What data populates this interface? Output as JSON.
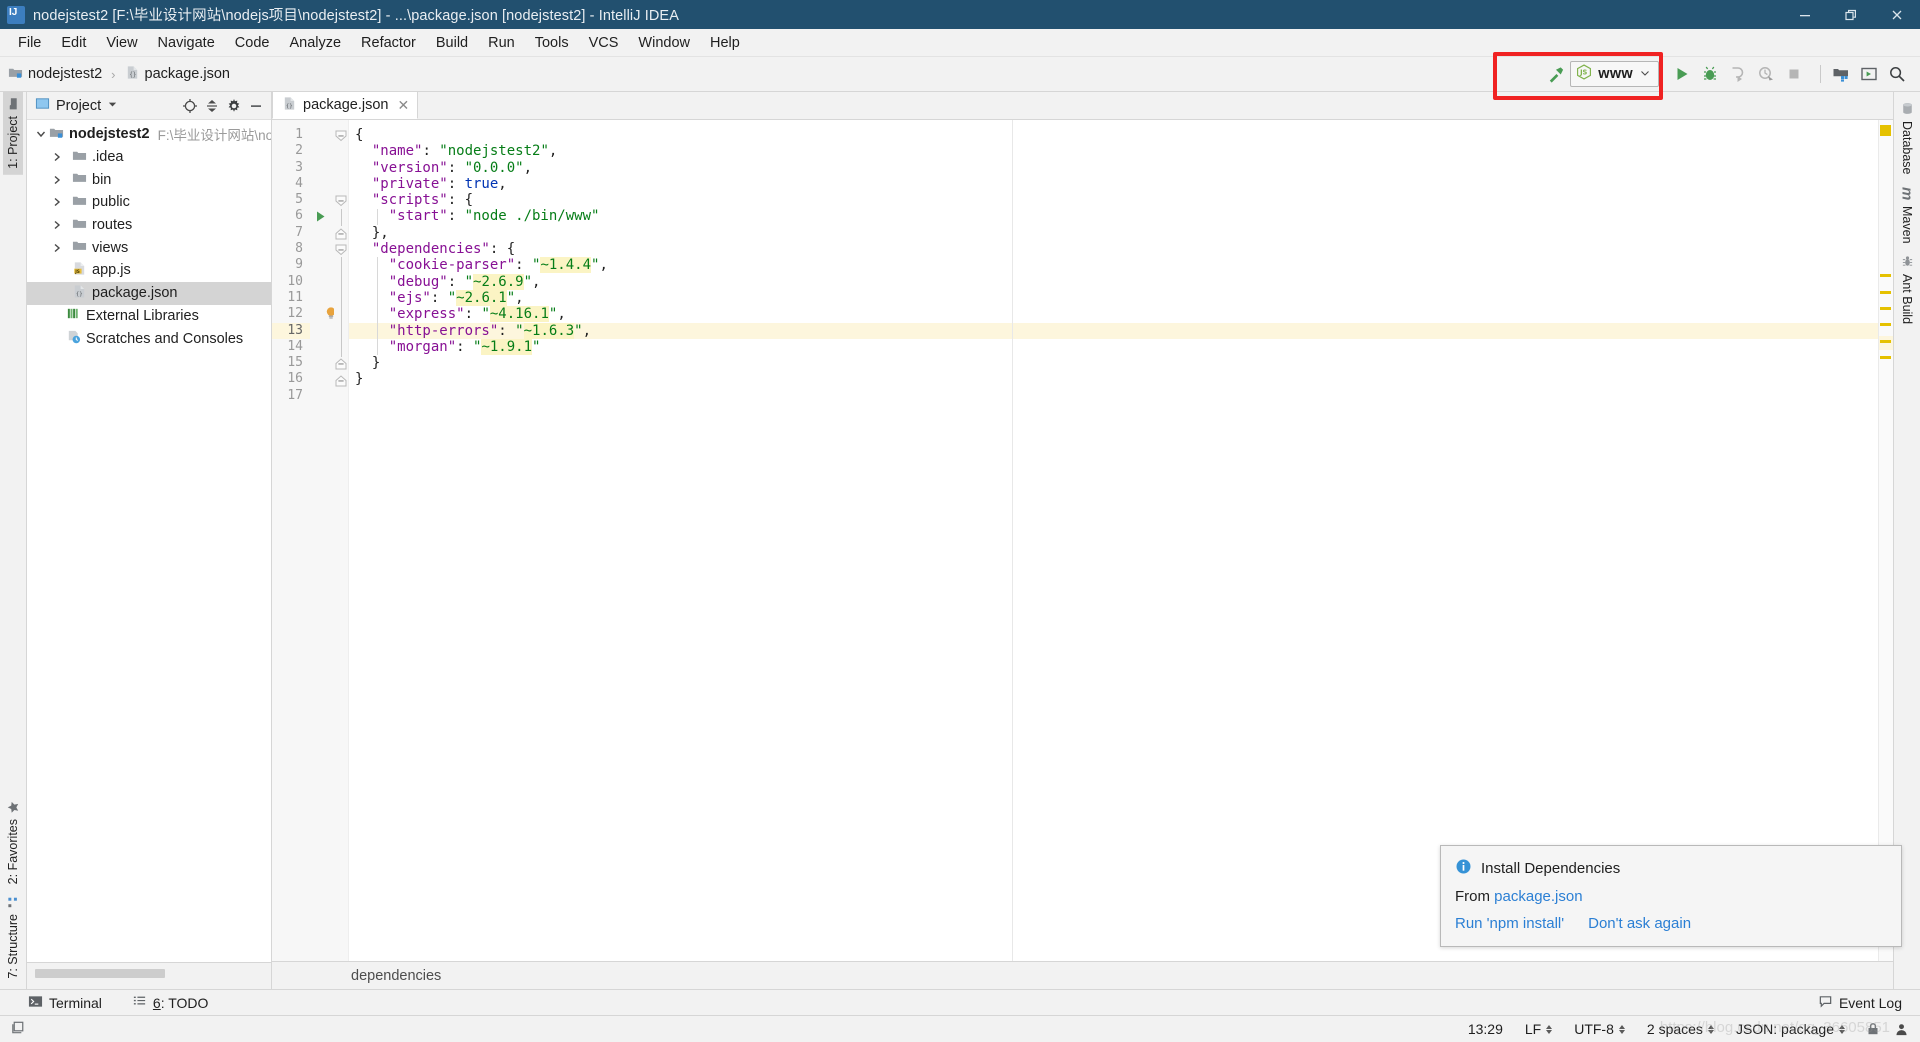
{
  "window": {
    "title": "nodejstest2 [F:\\毕业设计网站\\nodejs项目\\nodejstest2] - ...\\package.json [nodejstest2] - IntelliJ IDEA",
    "app_icon": "intellij-idea-icon",
    "minimize_label": "minimize-icon",
    "restore_label": "restore-icon",
    "close_label": "close-icon",
    "titlebar_color": "#22506f"
  },
  "menu": {
    "items": [
      {
        "label": "File"
      },
      {
        "label": "Edit"
      },
      {
        "label": "View"
      },
      {
        "label": "Navigate"
      },
      {
        "label": "Code"
      },
      {
        "label": "Analyze"
      },
      {
        "label": "Refactor"
      },
      {
        "label": "Build"
      },
      {
        "label": "Run"
      },
      {
        "label": "Tools"
      },
      {
        "label": "VCS"
      },
      {
        "label": "Window"
      },
      {
        "label": "Help"
      }
    ]
  },
  "navbar": {
    "breadcrumb": [
      {
        "label": "nodejstest2",
        "icon": "module-folder-icon"
      },
      {
        "label": "package.json",
        "icon": "json-file-icon"
      }
    ],
    "separator": "›",
    "build_button": "build-hammer-icon",
    "run_config": {
      "name": "www",
      "icon": "nodejs-icon",
      "dropdown": "chevron-down-icon"
    },
    "actions": [
      {
        "name": "run-button",
        "icon": "run-play-icon",
        "enabled": true
      },
      {
        "name": "debug-button",
        "icon": "debug-bug-icon",
        "enabled": true
      },
      {
        "name": "run-with-coverage-button",
        "icon": "coverage-icon",
        "enabled": false
      },
      {
        "name": "profile-button",
        "icon": "profiler-icon",
        "enabled": false
      },
      {
        "name": "stop-button",
        "icon": "stop-square-icon",
        "enabled": false
      }
    ],
    "right_actions": [
      {
        "name": "project-structure-button",
        "icon": "project-structure-icon"
      },
      {
        "name": "terminal-console-button",
        "icon": "console-window-icon"
      },
      {
        "name": "search-everywhere-button",
        "icon": "search-icon"
      }
    ],
    "highlight_color": "#f02222"
  },
  "left_strip": {
    "top_tabs": [
      {
        "label": "1: Project",
        "icon": "project-folder-icon",
        "active": true
      }
    ],
    "bottom_tabs": [
      {
        "label": "2: Favorites",
        "icon": "star-icon",
        "active": false
      },
      {
        "label": "7: Structure",
        "icon": "structure-icon",
        "active": false
      }
    ]
  },
  "right_strip": {
    "tabs": [
      {
        "label": "Database",
        "icon": "database-icon"
      },
      {
        "label": "Maven",
        "icon": "maven-m-icon"
      },
      {
        "label": "Ant Build",
        "icon": "ant-icon"
      }
    ]
  },
  "project_panel": {
    "title": "Project",
    "dropdown_icon": "chevron-down-icon",
    "toolbar": [
      {
        "name": "scroll-from-source-button",
        "icon": "target-icon"
      },
      {
        "name": "collapse-all-button",
        "icon": "collapse-all-icon"
      },
      {
        "name": "settings-button",
        "icon": "gear-icon"
      },
      {
        "name": "hide-button",
        "icon": "minus-icon"
      }
    ],
    "tree": [
      {
        "label": "nodejstest2",
        "path": "F:\\毕业设计网站\\nodej",
        "icon": "module-folder-icon",
        "indent": 0,
        "arrow": "expanded",
        "selected": false
      },
      {
        "label": ".idea",
        "icon": "folder-icon",
        "indent": 1,
        "arrow": "collapsed",
        "selected": false
      },
      {
        "label": "bin",
        "icon": "folder-icon",
        "indent": 1,
        "arrow": "collapsed",
        "selected": false
      },
      {
        "label": "public",
        "icon": "folder-icon",
        "indent": 1,
        "arrow": "collapsed",
        "selected": false
      },
      {
        "label": "routes",
        "icon": "folder-icon",
        "indent": 1,
        "arrow": "collapsed",
        "selected": false
      },
      {
        "label": "views",
        "icon": "folder-icon",
        "indent": 1,
        "arrow": "collapsed",
        "selected": false
      },
      {
        "label": "app.js",
        "icon": "js-file-icon",
        "indent": 1,
        "arrow": "none",
        "selected": false
      },
      {
        "label": "package.json",
        "icon": "json-file-icon",
        "indent": 1,
        "arrow": "none",
        "selected": true
      },
      {
        "label": "External Libraries",
        "icon": "libraries-icon",
        "indent": 0,
        "arrow": "none",
        "selected": false
      },
      {
        "label": "Scratches and Consoles",
        "icon": "scratches-icon",
        "indent": 0,
        "arrow": "none",
        "selected": false
      }
    ]
  },
  "editor": {
    "tabs": [
      {
        "label": "package.json",
        "icon": "json-file-icon",
        "active": true,
        "close_icon": "close-icon"
      }
    ],
    "breadcrumb_footer": "dependencies",
    "current_line": 13,
    "lines": [
      {
        "num": 1,
        "fold": "start",
        "run": false,
        "bulb": false,
        "tokens": [
          {
            "t": "{",
            "c": "p"
          }
        ]
      },
      {
        "num": 2,
        "fold": "none",
        "run": false,
        "bulb": false,
        "tokens": [
          {
            "t": "  \"name\"",
            "c": "k"
          },
          {
            "t": ": ",
            "c": "p"
          },
          {
            "t": "\"nodejstest2\"",
            "c": "s"
          },
          {
            "t": ",",
            "c": "p"
          }
        ]
      },
      {
        "num": 3,
        "fold": "none",
        "run": false,
        "bulb": false,
        "tokens": [
          {
            "t": "  \"version\"",
            "c": "k"
          },
          {
            "t": ": ",
            "c": "p"
          },
          {
            "t": "\"0.0.0\"",
            "c": "s"
          },
          {
            "t": ",",
            "c": "p"
          }
        ]
      },
      {
        "num": 4,
        "fold": "none",
        "run": false,
        "bulb": false,
        "tokens": [
          {
            "t": "  \"private\"",
            "c": "k"
          },
          {
            "t": ": ",
            "c": "p"
          },
          {
            "t": "true",
            "c": "b"
          },
          {
            "t": ",",
            "c": "p"
          }
        ]
      },
      {
        "num": 5,
        "fold": "start",
        "run": false,
        "bulb": false,
        "tokens": [
          {
            "t": "  \"scripts\"",
            "c": "k"
          },
          {
            "t": ": {",
            "c": "p"
          }
        ]
      },
      {
        "num": 6,
        "fold": "none",
        "run": true,
        "bulb": false,
        "tokens": [
          {
            "t": "    \"start\"",
            "c": "k"
          },
          {
            "t": ": ",
            "c": "p"
          },
          {
            "t": "\"node ./bin/www\"",
            "c": "s"
          }
        ]
      },
      {
        "num": 7,
        "fold": "end",
        "run": false,
        "bulb": false,
        "tokens": [
          {
            "t": "  },",
            "c": "p"
          }
        ]
      },
      {
        "num": 8,
        "fold": "start",
        "run": false,
        "bulb": false,
        "tokens": [
          {
            "t": "  \"dependencies\"",
            "c": "k"
          },
          {
            "t": ": {",
            "c": "p"
          }
        ]
      },
      {
        "num": 9,
        "fold": "none",
        "run": false,
        "bulb": false,
        "tokens": [
          {
            "t": "    \"cookie-parser\"",
            "c": "k"
          },
          {
            "t": ": ",
            "c": "p"
          },
          {
            "t": "\"",
            "c": "s"
          },
          {
            "t": "~1.4.4",
            "c": "s hl"
          },
          {
            "t": "\"",
            "c": "s"
          },
          {
            "t": ",",
            "c": "p"
          }
        ]
      },
      {
        "num": 10,
        "fold": "none",
        "run": false,
        "bulb": false,
        "tokens": [
          {
            "t": "    \"debug\"",
            "c": "k"
          },
          {
            "t": ": ",
            "c": "p"
          },
          {
            "t": "\"",
            "c": "s"
          },
          {
            "t": "~2.6.9",
            "c": "s hl"
          },
          {
            "t": "\"",
            "c": "s"
          },
          {
            "t": ",",
            "c": "p"
          }
        ]
      },
      {
        "num": 11,
        "fold": "none",
        "run": false,
        "bulb": false,
        "tokens": [
          {
            "t": "    \"ejs\"",
            "c": "k"
          },
          {
            "t": ": ",
            "c": "p"
          },
          {
            "t": "\"",
            "c": "s"
          },
          {
            "t": "~2.6.1",
            "c": "s hl"
          },
          {
            "t": "\"",
            "c": "s"
          },
          {
            "t": ",",
            "c": "p"
          }
        ]
      },
      {
        "num": 12,
        "fold": "none",
        "run": false,
        "bulb": true,
        "tokens": [
          {
            "t": "    \"express\"",
            "c": "k"
          },
          {
            "t": ": ",
            "c": "p"
          },
          {
            "t": "\"",
            "c": "s"
          },
          {
            "t": "~4.16.1",
            "c": "s hl"
          },
          {
            "t": "\"",
            "c": "s"
          },
          {
            "t": ",",
            "c": "p"
          }
        ]
      },
      {
        "num": 13,
        "fold": "none",
        "run": false,
        "bulb": false,
        "tokens": [
          {
            "t": "    \"http-errors\"",
            "c": "k"
          },
          {
            "t": ": ",
            "c": "p"
          },
          {
            "t": "\"",
            "c": "s"
          },
          {
            "t": "~1.6.3",
            "c": "s hl"
          },
          {
            "t": "\"",
            "c": "s"
          },
          {
            "t": ",",
            "c": "p"
          }
        ]
      },
      {
        "num": 14,
        "fold": "none",
        "run": false,
        "bulb": false,
        "tokens": [
          {
            "t": "    \"morgan\"",
            "c": "k"
          },
          {
            "t": ": ",
            "c": "p"
          },
          {
            "t": "\"",
            "c": "s"
          },
          {
            "t": "~1.9.1",
            "c": "s hl"
          },
          {
            "t": "\"",
            "c": "s"
          }
        ]
      },
      {
        "num": 15,
        "fold": "end",
        "run": false,
        "bulb": false,
        "tokens": [
          {
            "t": "  }",
            "c": "p"
          }
        ]
      },
      {
        "num": 16,
        "fold": "end",
        "run": false,
        "bulb": false,
        "tokens": [
          {
            "t": "}",
            "c": "p"
          }
        ]
      },
      {
        "num": 17,
        "fold": "none",
        "run": false,
        "bulb": false,
        "tokens": []
      }
    ],
    "markup_marks": [
      9,
      10,
      11,
      12,
      13,
      14
    ],
    "markup_color": "#e5c100"
  },
  "notification": {
    "icon": "info-icon",
    "title": "Install Dependencies",
    "from_label": "From",
    "from_link": "package.json",
    "actions": [
      {
        "label": "Run 'npm install'"
      },
      {
        "label": "Don't ask again"
      }
    ],
    "link_color": "#2b7fd4"
  },
  "bottom_toolwindows": [
    {
      "label": "Terminal",
      "icon": "terminal-icon",
      "shortcut": ""
    },
    {
      "label": "6: TODO",
      "icon": "todo-list-icon",
      "shortcut": "6"
    }
  ],
  "event_log": {
    "label": "Event Log",
    "icon": "balloon-icon"
  },
  "statusbar": {
    "caret_position": "13:29",
    "line_separator": "LF",
    "encoding": "UTF-8",
    "indent": "2 spaces",
    "file_type": "JSON: package",
    "lock_icon": "lock-icon",
    "inspector_icon": "inspector-icon"
  },
  "watermark": "https://blog.csdn.net/qq_36605851"
}
